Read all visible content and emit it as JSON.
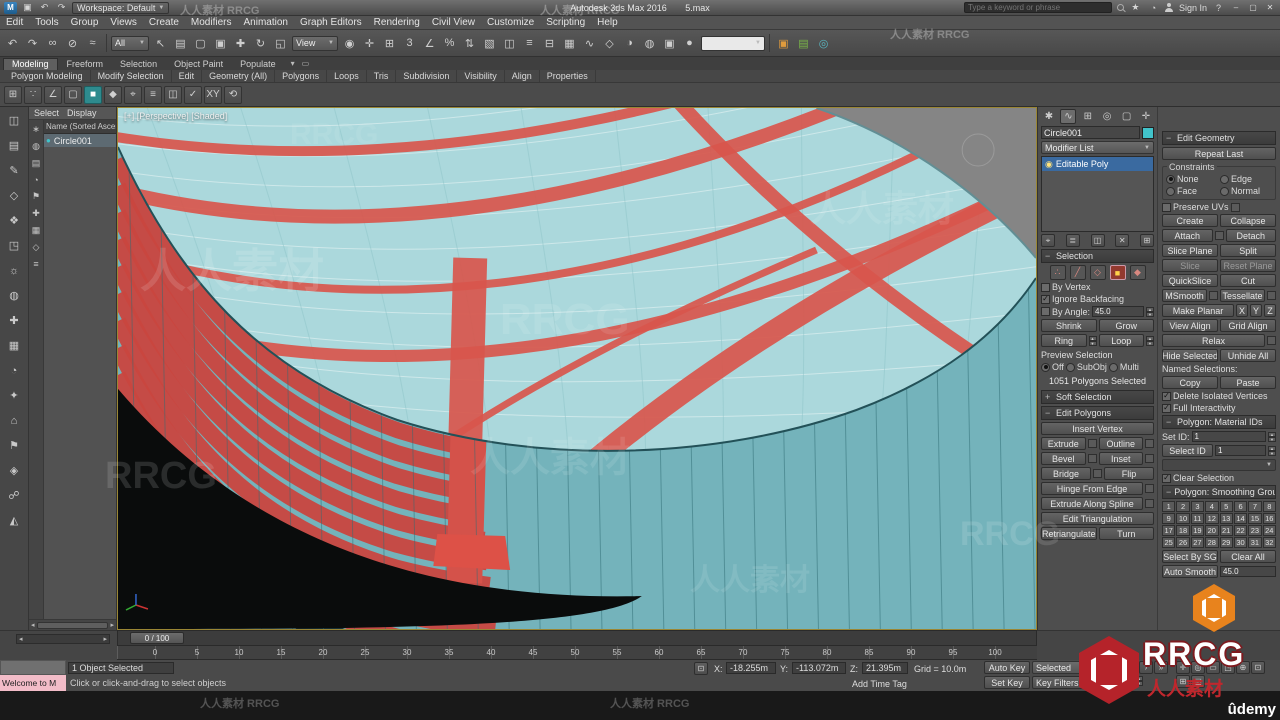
{
  "watermark": {
    "cn": "人人素材",
    "en": "RRCG",
    "logo_text": "RRCG",
    "logo_sub": "人人素材",
    "udemy": "ûdemy"
  },
  "titlebar": {
    "workspace": "Workspace: Default",
    "app_title": "Autodesk 3ds Max 2016",
    "doc_title": "5.max",
    "search_placeholder": "Type a keyword or phrase",
    "sign_in": "Sign In"
  },
  "menubar": {
    "items": [
      "Edit",
      "Tools",
      "Group",
      "Views",
      "Create",
      "Modifiers",
      "Animation",
      "Graph Editors",
      "Rendering",
      "Civil View",
      "Customize",
      "Scripting",
      "Help"
    ]
  },
  "toolbar": {
    "filter_value": "All",
    "coord_value": "View",
    "named_sets_value": "",
    "icons1": [
      [
        "undo-icon",
        "↶"
      ],
      [
        "redo-icon",
        "↷"
      ],
      [
        "select-and-link-icon",
        "∞"
      ],
      [
        "unlink-selection-icon",
        "⊘"
      ],
      [
        "bind-to-space-warp-icon",
        "≈"
      ]
    ],
    "icons2": [
      [
        "select-object-icon",
        "↖"
      ],
      [
        "select-by-name-icon",
        "▤"
      ],
      [
        "rectangular-selection-region-icon",
        "▢"
      ],
      [
        "window-crossing-icon",
        "▣"
      ],
      [
        "select-and-move-icon",
        "✚"
      ],
      [
        "select-and-rotate-icon",
        "↻"
      ],
      [
        "select-and-scale-icon",
        "◱"
      ]
    ],
    "icons3": [
      [
        "use-pivot-point-icon",
        "◉"
      ],
      [
        "select-and-manipulate-icon",
        "✛"
      ],
      [
        "keyboard-shortcut-override-icon",
        "⊞"
      ],
      [
        "snap-toggle-3d-icon",
        "3"
      ],
      [
        "angle-snap-icon",
        "∠"
      ],
      [
        "percent-snap-icon",
        "%"
      ],
      [
        "spinner-snap-icon",
        "⇅"
      ],
      [
        "edit-named-selection-sets-icon",
        "▧"
      ],
      [
        "mirror-icon",
        "◫"
      ],
      [
        "align-icon",
        "≡"
      ],
      [
        "layer-manager-icon",
        "⊟"
      ],
      [
        "graphite-ribbon-icon",
        "▦"
      ],
      [
        "curve-editor-icon",
        "∿"
      ],
      [
        "schematic-view-icon",
        "◇"
      ],
      [
        "material-editor-icon",
        "◑"
      ],
      [
        "render-setup-icon",
        "◍"
      ],
      [
        "rendered-frame-window-icon",
        "▣"
      ],
      [
        "render-production-icon",
        "●"
      ]
    ],
    "icons4": [
      [
        "container-icon",
        "▣"
      ],
      [
        "state-sets-icon",
        "▤"
      ],
      [
        "isolate-selection-icon",
        "◎"
      ]
    ]
  },
  "ribbon": {
    "tabs": [
      "Modeling",
      "Freeform",
      "Selection",
      "Object Paint",
      "Populate"
    ],
    "active_index": 0,
    "sections": [
      "Polygon Modeling",
      "Modify Selection",
      "Edit",
      "Geometry (All)",
      "Polygons",
      "Loops",
      "Tris",
      "Subdivision",
      "Visibility",
      "Align",
      "Properties"
    ],
    "icons": [
      [
        "ribbon-grid-icon",
        "⊞"
      ],
      [
        "vertex-mode-icon",
        "∵"
      ],
      [
        "edge-mode-icon",
        "∠"
      ],
      [
        "border-mode-icon",
        "▢"
      ],
      [
        "polygon-mode-icon",
        "■"
      ],
      [
        "element-mode-icon",
        "◆"
      ],
      [
        "pin-stack-icon",
        "⌖"
      ],
      [
        "show-end-result-icon",
        "≡"
      ],
      [
        "make-unique-icon",
        "◫"
      ],
      [
        "commit-icon",
        "✓"
      ],
      [
        "xy-constraint-icon",
        "XY"
      ],
      [
        "repeat-icon",
        "⟲"
      ]
    ],
    "highlight_index": 4
  },
  "left_toolbar": {
    "icons": [
      [
        "layers-panel-icon",
        "◫"
      ],
      [
        "scene-explorer-icon",
        "▤"
      ],
      [
        "edit-poly-icon",
        "✎"
      ],
      [
        "shapes-icon",
        "◇"
      ],
      [
        "snaps-icon",
        "❖"
      ],
      [
        "viewport-config-icon",
        "◳"
      ],
      [
        "lights-icon",
        "☼"
      ],
      [
        "render-tools-icon",
        "◍"
      ],
      [
        "add-object-icon",
        "✚"
      ],
      [
        "grid-icon",
        "▦"
      ],
      [
        "time-config-icon",
        "◔"
      ],
      [
        "star-icon",
        "✦"
      ],
      [
        "home-icon",
        "⌂"
      ],
      [
        "flag-icon",
        "⚑"
      ],
      [
        "material-icon",
        "◈"
      ],
      [
        "link-tool-icon",
        "☍"
      ],
      [
        "camera-icon",
        "◭"
      ]
    ]
  },
  "explorer": {
    "menus": [
      "Select",
      "Display"
    ],
    "column_header": "Name (Sorted Ascen...",
    "items": [
      {
        "label": "Circle001"
      }
    ],
    "side_icons": [
      [
        "display-all-icon",
        "∗"
      ],
      [
        "display-geometry-icon",
        "◍"
      ],
      [
        "display-shapes-icon",
        "▤"
      ],
      [
        "display-lights-icon",
        "◔"
      ],
      [
        "display-cameras-icon",
        "⚑"
      ],
      [
        "display-helpers-icon",
        "✚"
      ],
      [
        "display-materials-icon",
        "▦"
      ],
      [
        "display-bones-icon",
        "◇"
      ],
      [
        "sort-icon",
        "≡"
      ]
    ]
  },
  "viewport": {
    "label": "[+] [Perspective] [Shaded]",
    "time_slider": "0 / 100",
    "ruler": [
      "0",
      "5",
      "10",
      "15",
      "20",
      "25",
      "30",
      "35",
      "40",
      "45",
      "50",
      "55",
      "60",
      "65",
      "70",
      "75",
      "80",
      "85",
      "90",
      "95",
      "100"
    ]
  },
  "command_panel": {
    "tabs": [
      [
        "create-tab-icon",
        "✱"
      ],
      [
        "modify-tab-icon",
        "∿"
      ],
      [
        "hierarchy-tab-icon",
        "⊞"
      ],
      [
        "motion-tab-icon",
        "◎"
      ],
      [
        "display-tab-icon",
        "▢"
      ],
      [
        "utilities-tab-icon",
        "✛"
      ]
    ],
    "active_tab_index": 1,
    "object_name": "Circle001",
    "modifier_list_label": "Modifier List",
    "stack": [
      {
        "label": "Editable Poly"
      }
    ],
    "stack_buttons": [
      [
        "pin-stack-icon",
        "⌖"
      ],
      [
        "show-end-result-icon",
        "≣"
      ],
      [
        "make-unique-icon",
        "◫"
      ],
      [
        "remove-modifier-icon",
        "✕"
      ],
      [
        "configure-modifier-sets-icon",
        "⊞"
      ]
    ],
    "selection": {
      "title": "Selection",
      "subobject_icons": [
        [
          "vertex-subobject-icon",
          "∴"
        ],
        [
          "edge-subobject-icon",
          "╱"
        ],
        [
          "border-subobject-icon",
          "◇"
        ],
        [
          "polygon-subobject-icon",
          "■"
        ],
        [
          "element-subobject-icon",
          "◆"
        ]
      ],
      "active_subobject_index": 3,
      "by_vertex": "By Vertex",
      "ignore_backfacing": "Ignore Backfacing",
      "by_angle": "By Angle:",
      "by_angle_value": "45.0",
      "shrink": "Shrink",
      "grow": "Grow",
      "ring": "Ring",
      "loop": "Loop",
      "preview_label": "Preview Selection",
      "off": "Off",
      "subobj": "SubObj",
      "multi": "Multi",
      "status": "1051 Polygons Selected"
    },
    "soft_selection_title": "Soft Selection",
    "edit_polygons": {
      "title": "Edit Polygons",
      "insert_vertex": "Insert Vertex",
      "extrude": "Extrude",
      "outline": "Outline",
      "bevel": "Bevel",
      "inset": "Inset",
      "bridge": "Bridge",
      "flip": "Flip",
      "hinge": "Hinge From Edge",
      "extrude_spline": "Extrude Along Spline",
      "edit_tri": "Edit Triangulation",
      "retriangulate": "Retriangulate",
      "turn": "Turn"
    }
  },
  "edit_geometry": {
    "title": "Edit Geometry",
    "repeat_last": "Repeat Last",
    "constraints": "Constraints",
    "none": "None",
    "edge": "Edge",
    "face": "Face",
    "normal": "Normal",
    "preserve_uvs": "Preserve UVs",
    "create": "Create",
    "collapse": "Collapse",
    "attach": "Attach",
    "detach": "Detach",
    "slice_plane": "Slice Plane",
    "split": "Split",
    "slice": "Slice",
    "reset_plane": "Reset Plane",
    "quickslice": "QuickSlice",
    "cut": "Cut",
    "msmooth": "MSmooth",
    "tessellate": "Tessellate",
    "make_planar": "Make Planar",
    "x": "X",
    "y": "Y",
    "z": "Z",
    "view_align": "View Align",
    "grid_align": "Grid Align",
    "relax": "Relax",
    "hide_selected": "Hide Selected",
    "unhide_all": "Unhide All",
    "named_selections": "Named Selections:",
    "copy": "Copy",
    "paste": "Paste",
    "delete_isolated": "Delete Isolated Vertices",
    "full_interactivity": "Full Interactivity"
  },
  "material_ids": {
    "title": "Polygon: Material IDs",
    "set_id": "Set ID:",
    "set_id_value": "1",
    "select_id": "Select ID",
    "select_id_value": "1",
    "clear_selection": "Clear Selection"
  },
  "smoothing": {
    "title": "Polygon: Smoothing Groups",
    "numbers": [
      "1",
      "2",
      "3",
      "4",
      "5",
      "6",
      "7",
      "8",
      "9",
      "10",
      "11",
      "12",
      "13",
      "14",
      "15",
      "16",
      "17",
      "18",
      "19",
      "20",
      "21",
      "22",
      "23",
      "24",
      "25",
      "26",
      "27",
      "28",
      "29",
      "30",
      "31",
      "32"
    ],
    "select_by_sg": "Select By SG",
    "clear_all": "Clear All",
    "auto_smooth": "Auto Smooth",
    "auto_smooth_value": "45.0"
  },
  "statusbar": {
    "listener_text": "Welcome to M",
    "selection_status": "1 Object Selected",
    "prompt": "Click or click-and-drag to select objects",
    "x_label": "X:",
    "x_value": "-18.255m",
    "y_label": "Y:",
    "y_value": "-113.072m",
    "z_label": "Z:",
    "z_value": "21.395m",
    "grid_label": "Grid = 10.0m",
    "add_time_tag": "Add Time Tag"
  },
  "anim": {
    "auto_key": "Auto Key",
    "set_key": "Set Key",
    "selected_combo": "Selected",
    "key_filters": "Key Filters...",
    "transport": [
      [
        "go-to-start-button",
        "«"
      ],
      [
        "previous-frame-button",
        "‹"
      ],
      [
        "play-button",
        "▶"
      ],
      [
        "next-frame-button",
        "›"
      ],
      [
        "go-to-end-button",
        "»"
      ]
    ],
    "frame_value": "0",
    "nav": [
      [
        "pan-view-icon",
        "✛"
      ],
      [
        "orbit-view-icon",
        "◎"
      ],
      [
        "zoom-region-icon",
        "▭"
      ],
      [
        "maximize-viewport-icon",
        "◳"
      ],
      [
        "zoom-icon",
        "⊕"
      ],
      [
        "zoom-extents-icon",
        "⊡"
      ],
      [
        "zoom-all-icon",
        "⊞"
      ],
      [
        "field-of-view-icon",
        "◱"
      ]
    ]
  }
}
